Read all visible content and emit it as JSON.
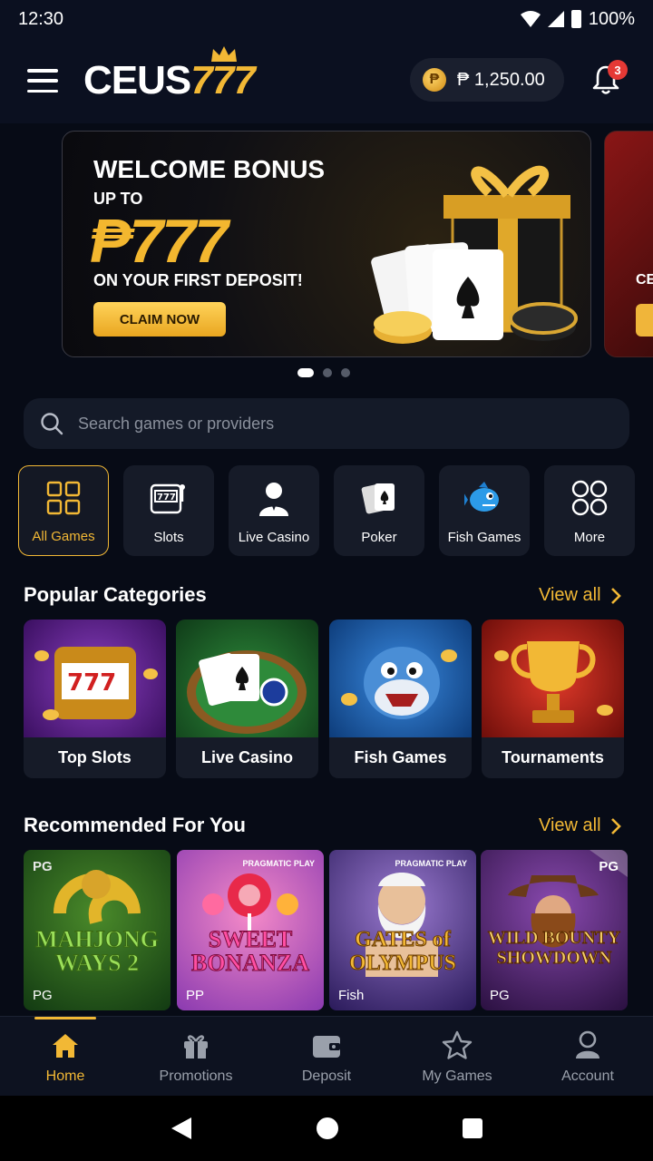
{
  "status": {
    "time": "12:30",
    "battery": "100%"
  },
  "header": {
    "logo_main": "CEUS",
    "logo_num": "777",
    "balance": "₱ 1,250.00",
    "notifications": "3"
  },
  "banner": {
    "title": "WELCOME BONUS",
    "up_to": "UP TO",
    "amount": "₱777",
    "subtitle": "ON YOUR FIRST DEPOSIT!",
    "cta": "CLAIM NOW",
    "peek_text": "CE"
  },
  "search": {
    "placeholder": "Search games or providers"
  },
  "categories": [
    {
      "label": "All Games",
      "icon": "grid-icon"
    },
    {
      "label": "Slots",
      "icon": "slot-machine-icon"
    },
    {
      "label": "Live Casino",
      "icon": "dealer-icon"
    },
    {
      "label": "Poker",
      "icon": "cards-icon"
    },
    {
      "label": "Fish Games",
      "icon": "fish-icon"
    },
    {
      "label": "More",
      "icon": "circles-icon"
    }
  ],
  "popular": {
    "title": "Popular Categories",
    "view_all": "View all",
    "items": [
      {
        "label": "Top Slots",
        "color": "#5a1f8a"
      },
      {
        "label": "Live Casino",
        "color": "#1f6b2e"
      },
      {
        "label": "Fish Games",
        "color": "#1a5fb0"
      },
      {
        "label": "Tournaments",
        "color": "#b41f1a"
      }
    ]
  },
  "recommended": {
    "title": "Recommended For You",
    "view_all": "View all",
    "items": [
      {
        "title": "MAHJONG WAYS 2",
        "provider": "PG",
        "tag": "PG"
      },
      {
        "title": "SWEET BONANZA",
        "provider": "PP",
        "tag": "PRAGMATIC PLAY"
      },
      {
        "title": "GATES of OLYMPUS",
        "provider": "Fish",
        "tag": "PRAGMATIC PLAY"
      },
      {
        "title": "WILD BOUNTY SHOWDOWN",
        "provider": "PG",
        "tag": "PG"
      }
    ]
  },
  "bottom_nav": [
    {
      "label": "Home",
      "icon": "home-icon"
    },
    {
      "label": "Promotions",
      "icon": "gift-icon"
    },
    {
      "label": "Deposit",
      "icon": "wallet-icon"
    },
    {
      "label": "My Games",
      "icon": "star-icon"
    },
    {
      "label": "Account",
      "icon": "user-icon"
    }
  ],
  "colors": {
    "accent": "#f2b835",
    "background": "#070b16",
    "card": "#161b28"
  }
}
